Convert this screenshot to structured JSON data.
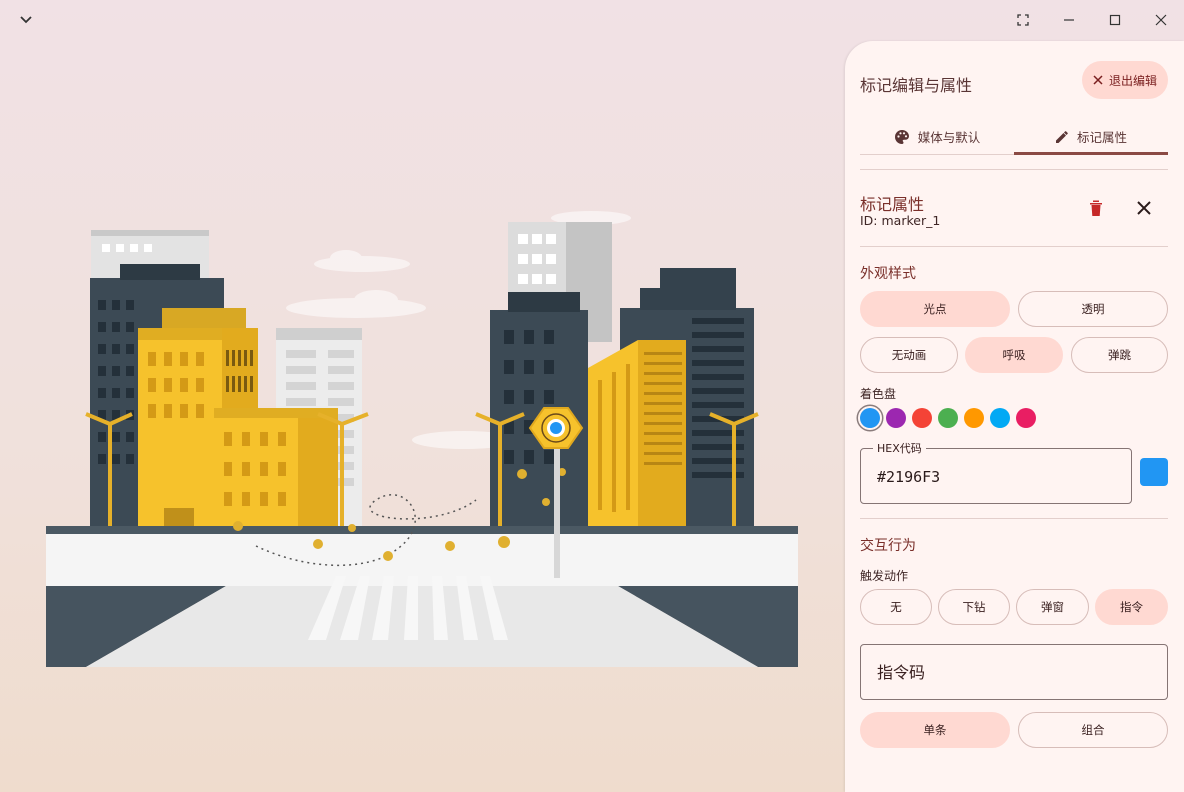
{
  "window": {
    "menu_icon": "chevron-down-icon",
    "controls": [
      "fullscreen-icon",
      "minimize-icon",
      "maximize-icon",
      "close-icon"
    ]
  },
  "panel": {
    "title": "标记编辑与属性",
    "exit_button": "退出编辑",
    "tabs": [
      {
        "label": "媒体与默认",
        "icon": "palette-icon"
      },
      {
        "label": "标记属性",
        "icon": "pencil-icon",
        "active": true
      }
    ],
    "marker": {
      "heading": "标记属性",
      "id": "ID: marker_1"
    },
    "appearance": {
      "title": "外观样式",
      "styles": [
        "光点",
        "透明"
      ],
      "selected_style": "光点",
      "animations": [
        "无动画",
        "呼吸",
        "弹跳"
      ],
      "selected_animation": "呼吸",
      "palette_label": "着色盘",
      "palette": [
        "#2196F3",
        "#9C27B0",
        "#F44336",
        "#4CAF50",
        "#FF9800",
        "#03A9F4",
        "#E91E63"
      ],
      "selected_color": "#2196F3",
      "hex_label": "HEX代码",
      "hex_value": "#2196F3"
    },
    "interaction": {
      "title": "交互行为",
      "trigger_label": "触发动作",
      "triggers": [
        "无",
        "下钻",
        "弹窗",
        "指令"
      ],
      "selected_trigger": "指令",
      "command_placeholder": "指令码",
      "modes": [
        "单条",
        "组合"
      ],
      "selected_mode": "单条"
    }
  },
  "colors": {
    "accent": "#8b4a44",
    "selected_bg": "#ffd9d2",
    "panel_bg": "#fff4f2",
    "delete": "#c62828"
  }
}
